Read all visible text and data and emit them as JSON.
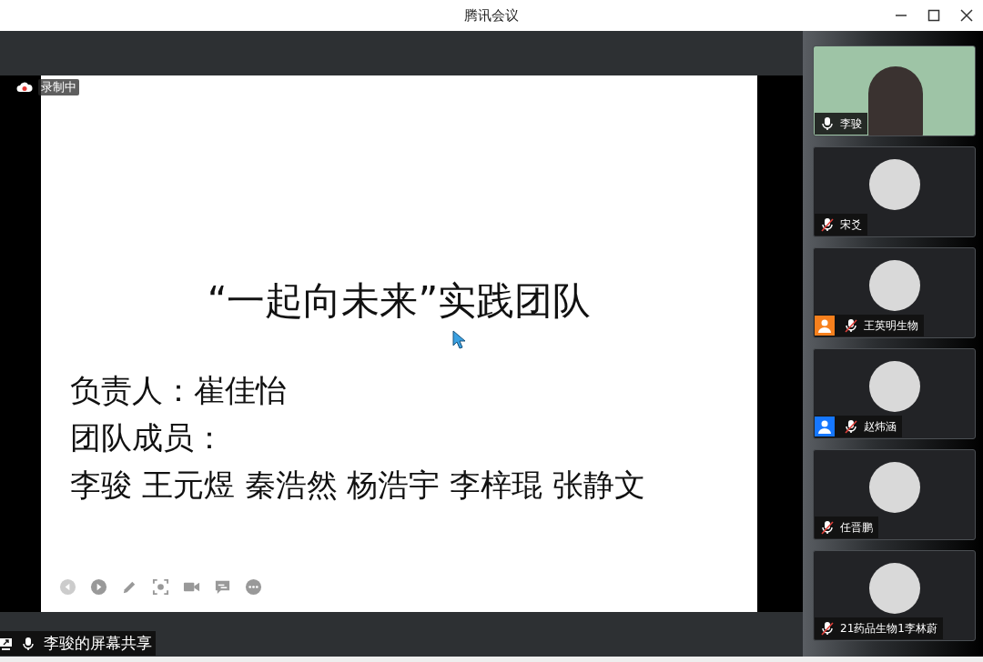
{
  "window": {
    "title": "腾讯会议"
  },
  "recording": {
    "label": "录制中"
  },
  "slide": {
    "title": "“一起向未来”实践团队",
    "lines": [
      "负责人：崔佳怡",
      "团队成员：",
      "李骏 王元煜 秦浩然 杨浩宇 李梓琨 张静文"
    ]
  },
  "share_label": {
    "text": "李骏的屏幕共享"
  },
  "participants": [
    {
      "kind": "video",
      "name": "李骏",
      "muted": false
    },
    {
      "kind": "avatar",
      "name": "宋爻",
      "muted": true
    },
    {
      "kind": "avatar",
      "name": "王英明生物",
      "muted": true,
      "color": "#f7801d"
    },
    {
      "kind": "avatar",
      "name": "赵炜涵",
      "muted": true,
      "color": "#1677ff"
    },
    {
      "kind": "avatar",
      "name": "任晋鹏",
      "muted": true
    },
    {
      "kind": "avatar",
      "name": "21药品生物1李林蔚",
      "muted": true
    }
  ]
}
